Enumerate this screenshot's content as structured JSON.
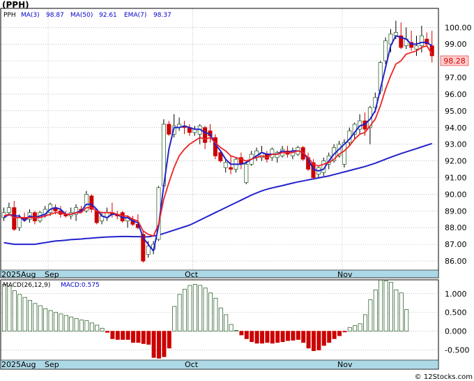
{
  "header": {
    "title": "(PPH)",
    "legend": [
      {
        "text": "PPH",
        "color": "#000000"
      },
      {
        "text": "MA(3)",
        "color": "#0000cc"
      },
      {
        "text": "98.87",
        "color": "#0000cc"
      },
      {
        "text": "MA(50)",
        "color": "#0000cc"
      },
      {
        "text": "92.61",
        "color": "#0000cc"
      },
      {
        "text": "EMA(7)",
        "color": "#0000cc"
      },
      {
        "text": "98.37",
        "color": "#0000cc"
      }
    ]
  },
  "macd_legend": [
    {
      "text": "MACD(26,12,9)",
      "color": "#000000"
    },
    {
      "text": "MACD:0.575",
      "color": "#0000cc"
    }
  ],
  "last_price_tag": "98.28",
  "watermark": "© 12Stocks.com",
  "colors": {
    "up_candle": "#336633",
    "down_candle": "#cc0000",
    "ma_short": "#2222cc",
    "ma_long": "#2222cc",
    "ema": "#ee2222",
    "grid": "#999999",
    "date_bar": "#add8e6",
    "price_tag_bg": "#ffcccc",
    "price_tag_fg": "#cc0000",
    "macd_pos": "#336633",
    "macd_neg": "#cc0000"
  },
  "chart_data": [
    {
      "type": "candlestick",
      "title": "(PPH)",
      "y_ticks": [
        "100.00",
        "99.00",
        "98.00",
        "97.00",
        "96.00",
        "95.00",
        "94.00",
        "93.00",
        "92.00",
        "91.00",
        "90.00",
        "89.00",
        "88.00",
        "87.00",
        "86.00"
      ],
      "ylim": [
        85.5,
        101.1
      ],
      "x_date_labels": [
        "2025Aug",
        "Sep",
        "Oct",
        "Nov"
      ],
      "x_label_index": [
        0,
        9,
        37,
        66
      ],
      "candles": [
        [
          88.6,
          89.2,
          88.4,
          88.9
        ],
        [
          88.9,
          89.5,
          88.7,
          89.2
        ],
        [
          89.2,
          89.6,
          87.8,
          87.9
        ],
        [
          88.0,
          88.8,
          87.8,
          88.6
        ],
        [
          88.6,
          88.9,
          88.4,
          88.5
        ],
        [
          88.5,
          89.1,
          88.3,
          88.9
        ],
        [
          88.9,
          89.0,
          88.2,
          88.4
        ],
        [
          88.4,
          89.0,
          88.3,
          88.9
        ],
        [
          88.8,
          89.3,
          88.6,
          89.1
        ],
        [
          88.9,
          89.5,
          88.7,
          89.4
        ],
        [
          89.2,
          89.4,
          88.8,
          89.0
        ],
        [
          89.0,
          89.3,
          88.6,
          88.8
        ],
        [
          88.8,
          89.0,
          88.6,
          88.7
        ],
        [
          88.7,
          89.2,
          88.5,
          88.9
        ],
        [
          88.8,
          89.4,
          88.4,
          89.2
        ],
        [
          89.1,
          89.3,
          88.9,
          89.0
        ],
        [
          89.0,
          90.2,
          88.9,
          90.0
        ],
        [
          89.9,
          90.0,
          88.9,
          89.1
        ],
        [
          89.0,
          89.1,
          88.2,
          88.3
        ],
        [
          88.4,
          88.9,
          88.2,
          88.7
        ],
        [
          88.6,
          89.2,
          88.4,
          88.9
        ],
        [
          88.9,
          89.5,
          88.6,
          88.8
        ],
        [
          88.8,
          89.0,
          88.5,
          88.7
        ],
        [
          88.9,
          89.0,
          88.3,
          88.4
        ],
        [
          88.4,
          88.7,
          88.0,
          88.6
        ],
        [
          88.5,
          88.7,
          88.1,
          88.2
        ],
        [
          88.2,
          88.8,
          87.9,
          88.0
        ],
        [
          87.6,
          87.8,
          85.9,
          86.0
        ],
        [
          86.4,
          87.2,
          86.2,
          86.9
        ],
        [
          86.7,
          87.2,
          86.4,
          87.0
        ],
        [
          87.3,
          90.5,
          87.2,
          90.4
        ],
        [
          90.5,
          94.5,
          90.4,
          94.2
        ],
        [
          94.2,
          94.4,
          93.5,
          93.6
        ],
        [
          93.6,
          94.8,
          93.4,
          94.1
        ],
        [
          94.0,
          94.6,
          93.8,
          94.2
        ],
        [
          94.1,
          94.4,
          93.6,
          94.0
        ],
        [
          94.0,
          94.2,
          93.5,
          93.7
        ],
        [
          93.7,
          94.1,
          93.5,
          93.9
        ],
        [
          93.6,
          94.2,
          93.0,
          94.1
        ],
        [
          94.0,
          94.1,
          92.7,
          93.1
        ],
        [
          93.8,
          94.2,
          93.1,
          93.5
        ],
        [
          93.4,
          93.6,
          92.1,
          92.3
        ],
        [
          92.5,
          92.6,
          91.9,
          92.0
        ],
        [
          91.6,
          92.1,
          91.3,
          91.9
        ],
        [
          91.6,
          92.3,
          91.2,
          91.5
        ],
        [
          91.5,
          92.2,
          91.3,
          92.1
        ],
        [
          92.2,
          92.5,
          91.5,
          91.8
        ],
        [
          90.7,
          92.0,
          90.6,
          91.8
        ],
        [
          91.8,
          92.6,
          91.7,
          92.4
        ],
        [
          92.2,
          92.8,
          92.0,
          92.6
        ],
        [
          92.2,
          92.9,
          92.0,
          92.5
        ],
        [
          92.4,
          92.6,
          91.9,
          92.1
        ],
        [
          92.2,
          92.8,
          92.0,
          92.7
        ],
        [
          92.2,
          92.6,
          91.9,
          92.5
        ],
        [
          92.3,
          92.9,
          92.2,
          92.7
        ],
        [
          92.6,
          92.9,
          92.2,
          92.4
        ],
        [
          92.3,
          92.8,
          92.1,
          92.6
        ],
        [
          92.4,
          92.9,
          92.3,
          92.8
        ],
        [
          92.8,
          92.9,
          92.0,
          92.1
        ],
        [
          92.2,
          92.5,
          91.4,
          91.5
        ],
        [
          91.9,
          92.1,
          90.9,
          91.0
        ],
        [
          91.2,
          91.7,
          91.0,
          91.6
        ],
        [
          91.3,
          92.2,
          91.1,
          92.0
        ],
        [
          91.8,
          92.5,
          91.5,
          92.3
        ],
        [
          92.0,
          93.0,
          91.9,
          92.8
        ],
        [
          92.3,
          93.2,
          92.2,
          93.0
        ],
        [
          91.8,
          93.3,
          91.6,
          93.1
        ],
        [
          93.1,
          94.0,
          92.9,
          93.8
        ],
        [
          93.6,
          94.3,
          93.3,
          94.2
        ],
        [
          93.9,
          94.8,
          93.6,
          94.4
        ],
        [
          94.4,
          94.9,
          93.5,
          93.9
        ],
        [
          94.0,
          95.3,
          93.0,
          95.2
        ],
        [
          95.2,
          96.1,
          94.9,
          95.8
        ],
        [
          96.2,
          98.0,
          96.0,
          97.9
        ],
        [
          98.0,
          99.4,
          97.8,
          99.2
        ],
        [
          99.0,
          99.9,
          98.5,
          99.6
        ],
        [
          99.5,
          100.4,
          99.3,
          99.7
        ],
        [
          99.5,
          100.3,
          98.7,
          98.8
        ],
        [
          98.9,
          100.0,
          98.7,
          99.3
        ],
        [
          99.1,
          99.8,
          98.6,
          98.8
        ],
        [
          98.7,
          99.5,
          98.3,
          98.9
        ],
        [
          98.9,
          100.1,
          98.5,
          99.5
        ],
        [
          99.3,
          99.7,
          98.9,
          99.0
        ],
        [
          98.9,
          99.8,
          97.9,
          98.3
        ]
      ],
      "series": [
        {
          "name": "MA(3)",
          "color": "#2222cc",
          "values": [
            88.6,
            88.8,
            88.7,
            88.7,
            88.4,
            88.7,
            88.6,
            88.7,
            88.8,
            89.1,
            89.2,
            89.1,
            88.8,
            88.8,
            88.9,
            89.0,
            89.4,
            89.4,
            89.1,
            88.7,
            88.6,
            88.8,
            88.8,
            88.6,
            88.6,
            88.4,
            88.3,
            87.4,
            87.0,
            86.6,
            88.1,
            90.5,
            92.7,
            94.0,
            94.0,
            94.1,
            94.0,
            93.9,
            93.9,
            93.7,
            93.6,
            93.0,
            92.6,
            92.1,
            91.8,
            91.8,
            91.8,
            91.9,
            92.1,
            92.3,
            92.5,
            92.4,
            92.4,
            92.4,
            92.6,
            92.5,
            92.6,
            92.6,
            92.5,
            92.1,
            91.5,
            91.4,
            91.5,
            92.0,
            92.4,
            92.7,
            93.0,
            93.3,
            93.7,
            94.1,
            94.2,
            94.5,
            95.0,
            96.3,
            97.6,
            98.9,
            99.5,
            99.4,
            99.3,
            99.0,
            99.0,
            99.1,
            99.1,
            98.9
          ]
        },
        {
          "name": "EMA(7)",
          "color": "#ee2222",
          "values": [
            88.7,
            88.8,
            88.6,
            88.6,
            88.6,
            88.6,
            88.6,
            88.6,
            88.7,
            88.8,
            88.9,
            88.9,
            88.8,
            88.8,
            88.9,
            88.9,
            89.2,
            89.2,
            89.0,
            88.9,
            88.9,
            88.9,
            88.8,
            88.7,
            88.7,
            88.5,
            88.4,
            87.8,
            87.6,
            87.5,
            88.2,
            89.7,
            90.7,
            91.6,
            92.3,
            92.7,
            93.0,
            93.2,
            93.4,
            93.3,
            93.4,
            93.1,
            92.8,
            92.6,
            92.3,
            92.2,
            92.1,
            92.0,
            92.1,
            92.2,
            92.3,
            92.2,
            92.4,
            92.4,
            92.5,
            92.5,
            92.5,
            92.6,
            92.5,
            92.2,
            91.8,
            91.7,
            91.8,
            91.9,
            92.1,
            92.4,
            92.6,
            92.9,
            93.3,
            93.6,
            93.7,
            94.1,
            94.5,
            95.3,
            96.3,
            97.1,
            97.8,
            98.0,
            98.4,
            98.5,
            98.6,
            98.8,
            98.9,
            98.4
          ]
        },
        {
          "name": "MA(50)",
          "color": "#2222cc",
          "values": [
            87.1,
            87.05,
            87.0,
            87.0,
            87.0,
            87.0,
            87.0,
            87.05,
            87.1,
            87.15,
            87.2,
            87.22,
            87.25,
            87.28,
            87.3,
            87.32,
            87.35,
            87.37,
            87.4,
            87.42,
            87.44,
            87.45,
            87.46,
            87.47,
            87.47,
            87.46,
            87.46,
            87.45,
            87.45,
            87.5,
            87.55,
            87.65,
            87.75,
            87.85,
            87.95,
            88.05,
            88.15,
            88.3,
            88.45,
            88.6,
            88.75,
            88.9,
            89.05,
            89.2,
            89.35,
            89.5,
            89.65,
            89.8,
            89.95,
            90.08,
            90.2,
            90.3,
            90.38,
            90.45,
            90.52,
            90.6,
            90.67,
            90.74,
            90.8,
            90.86,
            90.92,
            90.98,
            91.04,
            91.1,
            91.18,
            91.26,
            91.34,
            91.42,
            91.5,
            91.58,
            91.66,
            91.76,
            91.86,
            91.98,
            92.1,
            92.22,
            92.33,
            92.44,
            92.54,
            92.64,
            92.74,
            92.84,
            92.94,
            93.04
          ]
        }
      ]
    },
    {
      "type": "bar",
      "title": "MACD(26,12,9)",
      "y_ticks": [
        "1.000",
        "0.500",
        "0.000",
        "-0.500"
      ],
      "ylim": [
        -0.75,
        1.35
      ],
      "x_date_labels": [
        "2025Aug",
        "Sep",
        "Oct",
        "Nov"
      ],
      "values": [
        1.25,
        1.2,
        1.08,
        0.98,
        0.9,
        0.82,
        0.74,
        0.68,
        0.6,
        0.55,
        0.5,
        0.46,
        0.42,
        0.38,
        0.34,
        0.3,
        0.28,
        0.22,
        0.16,
        0.08,
        -0.03,
        -0.2,
        -0.22,
        -0.22,
        -0.22,
        -0.3,
        -0.3,
        -0.33,
        -0.35,
        -0.7,
        -0.72,
        -0.68,
        -0.45,
        0.66,
        0.98,
        1.12,
        1.22,
        1.25,
        1.22,
        1.15,
        1.02,
        0.88,
        0.62,
        0.44,
        0.18,
        0.02,
        -0.1,
        -0.2,
        -0.28,
        -0.32,
        -0.32,
        -0.3,
        -0.32,
        -0.3,
        -0.28,
        -0.25,
        -0.24,
        -0.22,
        -0.3,
        -0.45,
        -0.52,
        -0.5,
        -0.38,
        -0.3,
        -0.2,
        -0.12,
        -0.02,
        0.1,
        0.15,
        0.2,
        0.44,
        0.84,
        1.1,
        1.36,
        1.34,
        1.3,
        1.1,
        1.02,
        0.58
      ]
    }
  ]
}
